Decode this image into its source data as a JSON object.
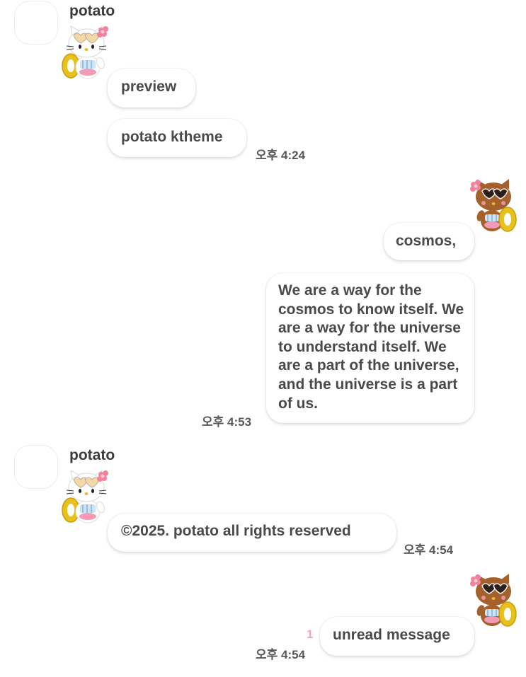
{
  "messages": [
    {
      "type": "received",
      "sender": "potato",
      "bubbles": [
        "preview",
        "potato ktheme"
      ],
      "time": "오후 4:24"
    },
    {
      "type": "sent",
      "bubbles": [
        "cosmos,",
        "We are a way for the cosmos to know itself. We are a way for the universe to understand itself. We are a part of the universe, and the universe is a part of us."
      ],
      "time": "오후 4:53"
    },
    {
      "type": "received",
      "sender": "potato",
      "bubbles": [
        "©2025. potato all rights reserved"
      ],
      "time": "오후 4:54"
    },
    {
      "type": "sent",
      "bubbles": [
        "unread message"
      ],
      "unread_count": "1",
      "time": "오후 4:54"
    }
  ],
  "icons": {
    "received_sticker": "hello-kitty-white-sticker-icon",
    "sent_sticker": "hello-kitty-brown-sticker-icon"
  },
  "colors": {
    "background": "#ffffff",
    "bubble": "#ffffff",
    "text": "#4a4a4a",
    "unread": "#f2a3b5"
  }
}
